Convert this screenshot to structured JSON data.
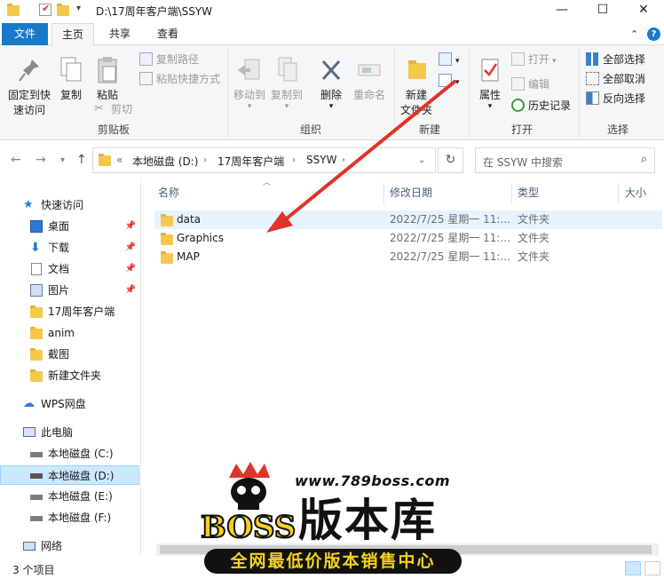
{
  "window": {
    "title_path": "D:\\17周年客户端\\SSYW",
    "minimize": "—",
    "maximize": "☐",
    "close": "✕"
  },
  "ribbon_tabs": [
    "文件",
    "主页",
    "共享",
    "查看"
  ],
  "ribbon": {
    "clipboard": {
      "pin_label_1": "固定到快",
      "pin_label_2": "速访问",
      "copy": "复制",
      "paste": "粘贴",
      "copy_path": "复制路径",
      "paste_shortcut": "粘贴快捷方式",
      "cut": "剪切",
      "group": "剪贴板"
    },
    "organize": {
      "move_to": "移动到",
      "copy_to": "复制到",
      "delete": "删除",
      "rename": "重命名",
      "group": "组织"
    },
    "new": {
      "new_folder_1": "新建",
      "new_folder_2": "文件夹",
      "group": "新建"
    },
    "open": {
      "properties": "属性",
      "open": "打开",
      "edit": "编辑",
      "history": "历史记录",
      "group": "打开"
    },
    "select": {
      "select_all": "全部选择",
      "select_none": "全部取消",
      "invert": "反向选择",
      "group": "选择"
    }
  },
  "address_bar": {
    "overflow": "«",
    "crumbs": [
      "本地磁盘 (D:)",
      "17周年客户端",
      "SSYW"
    ],
    "search_placeholder": "在 SSYW 中搜索"
  },
  "nav_pane": {
    "quick_access": "快速访问",
    "items": [
      {
        "label": "桌面",
        "pinned": true
      },
      {
        "label": "下载",
        "pinned": true
      },
      {
        "label": "文档",
        "pinned": true
      },
      {
        "label": "图片",
        "pinned": true
      },
      {
        "label": "17周年客户端",
        "pinned": false
      },
      {
        "label": "anim",
        "pinned": false
      },
      {
        "label": "截图",
        "pinned": false
      },
      {
        "label": "新建文件夹",
        "pinned": false
      }
    ],
    "wps": "WPS网盘",
    "this_pc": "此电脑",
    "drives": [
      "本地磁盘 (C:)",
      "本地磁盘 (D:)",
      "本地磁盘 (E:)",
      "本地磁盘 (F:)"
    ],
    "network": "网络"
  },
  "columns": {
    "name": "名称",
    "modified": "修改日期",
    "type": "类型",
    "size": "大小"
  },
  "files": [
    {
      "name": "data",
      "modified": "2022/7/25 星期一 11:...",
      "type": "文件夹"
    },
    {
      "name": "Graphics",
      "modified": "2022/7/25 星期一 11:...",
      "type": "文件夹"
    },
    {
      "name": "MAP",
      "modified": "2022/7/25 星期一 11:...",
      "type": "文件夹"
    }
  ],
  "status": {
    "count": "3 个项目"
  },
  "watermark": {
    "url": "www.789boss.com",
    "brand": "BOSS",
    "title": "版本库",
    "banner": "全网最低价版本销售中心"
  },
  "colors": {
    "accent": "#1979ca",
    "folder": "#f5c84c",
    "selected": "#cce8ff",
    "arrow": "#e0342a"
  }
}
